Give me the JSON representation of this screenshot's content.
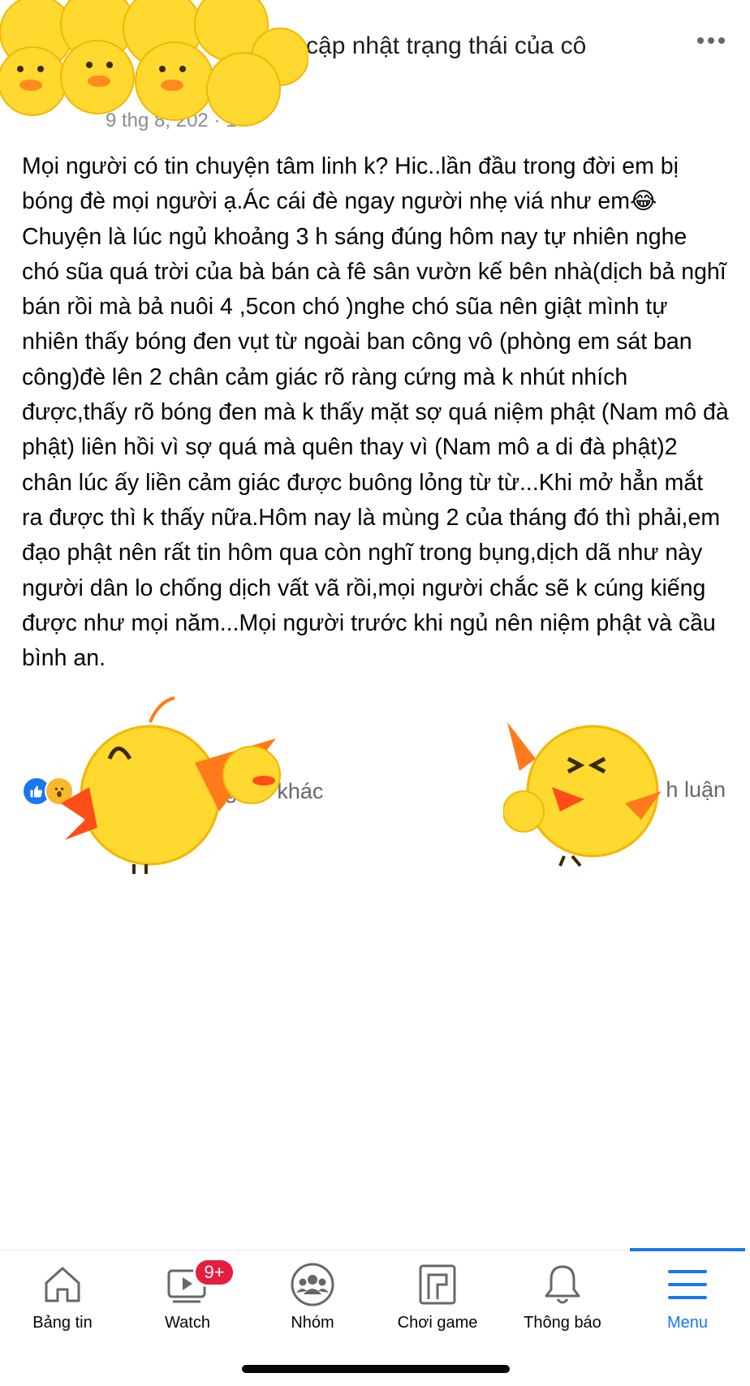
{
  "header": {
    "status_text": "ã cập nhật trạng thái của cô",
    "meta_text": "9 thg 8, 202 · 1"
  },
  "post": {
    "body": "Mọi người có tin chuyện tâm linh k? Hic..lần đầu trong đời em bị bóng đè mọi người ạ.Ác cái đè ngay người nhẹ viá như em😂Chuyện là lúc ngủ khoảng 3 h sáng đúng hôm nay tự nhiên nghe chó sũa quá trời của bà bán cà fê sân vườn kế bên nhà(dịch bả nghĩ bán rồi mà bả nuôi 4 ,5con chó )nghe chó sũa nên giật mình tự nhiên thấy bóng đen vụt từ ngoài ban công vô (phòng em sát ban công)đè lên 2 chân cảm giác rõ ràng cứng mà k nhút nhích được,thấy rõ bóng đen mà k thấy mặt sợ quá niệm phật (Nam mô đà phật) liên hồi vì sợ quá mà quên thay vì (Nam mô a di đà phật)2 chân lúc ấy liền cảm giác được buông lỏng từ từ...Khi mở hẳn mắt ra được thì k thấy nữa.Hôm nay là mùng 2 của tháng đó thì phải,em đạo phật nên rất tin hôm qua còn nghĩ trong bụng,dịch dã như này người dân lo chống dịch vất vã rồi,mọi người chắc sẽ k cúng kiếng được như mọi năm...Mọi người trước khi ngủ nên niệm phật và cầu bình an."
  },
  "reactions": {
    "summary_text": "Thu Thủy và người khác",
    "comments_text": "h luận"
  },
  "tabbar": {
    "items": [
      {
        "label": "Bảng tin",
        "icon": "home-icon"
      },
      {
        "label": "Watch",
        "icon": "watch-icon"
      },
      {
        "label": "Nhóm",
        "icon": "groups-icon"
      },
      {
        "label": "Chơi game",
        "icon": "gaming-icon"
      },
      {
        "label": "Thông báo",
        "icon": "bell-icon"
      },
      {
        "label": "Menu",
        "icon": "menu-icon"
      }
    ],
    "watch_badge": "9+",
    "active_color": "#1877f2"
  }
}
